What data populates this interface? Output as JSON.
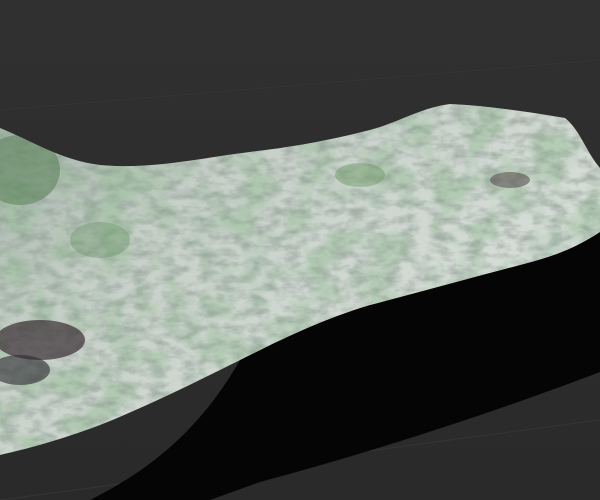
{
  "scene": {
    "subject": "3d-terrain-render",
    "colors": {
      "background": "#2e2e2e",
      "shadow": "#050505",
      "rock": "#c9d1cb",
      "vegetation": "#5f8a5a",
      "dark_rock": "#3a2f35"
    }
  }
}
